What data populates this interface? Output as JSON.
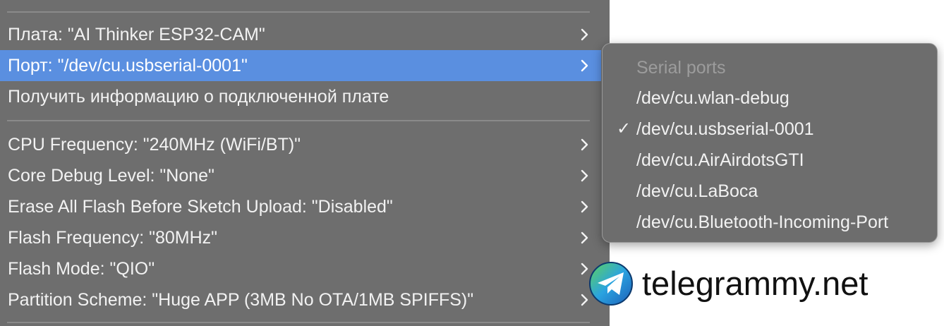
{
  "menu": {
    "items": [
      {
        "label": "Плата: \"AI Thinker ESP32-CAM\"",
        "has_submenu": true
      },
      {
        "label": "Порт: \"/dev/cu.usbserial-0001\"",
        "has_submenu": true,
        "highlighted": true
      },
      {
        "label": "Получить информацию о подключенной плате",
        "has_submenu": false
      },
      {
        "label": "CPU Frequency: \"240MHz (WiFi/BT)\"",
        "has_submenu": true
      },
      {
        "label": "Core Debug Level: \"None\"",
        "has_submenu": true
      },
      {
        "label": "Erase All Flash Before Sketch Upload: \"Disabled\"",
        "has_submenu": true
      },
      {
        "label": "Flash Frequency: \"80MHz\"",
        "has_submenu": true
      },
      {
        "label": "Flash Mode: \"QIO\"",
        "has_submenu": true
      },
      {
        "label": "Partition Scheme: \"Huge APP (3MB No OTA/1MB SPIFFS)\"",
        "has_submenu": true
      }
    ],
    "chevron_icon": "chevron-right-icon"
  },
  "submenu": {
    "header": "Serial ports",
    "check_glyph": "✓",
    "items": [
      {
        "label": "/dev/cu.wlan-debug",
        "checked": false
      },
      {
        "label": "/dev/cu.usbserial-0001",
        "checked": true
      },
      {
        "label": "/dev/cu.AirAirdotsGTI",
        "checked": false
      },
      {
        "label": "/dev/cu.LaBoca",
        "checked": false
      },
      {
        "label": "/dev/cu.Bluetooth-Incoming-Port",
        "checked": false
      }
    ]
  },
  "watermark": {
    "text": "telegrammy.net",
    "icon": "telegram-logo-icon"
  },
  "colors": {
    "menu_bg": "#6e6e6e",
    "highlight": "#5a8fe0",
    "text": "#f2f2f2",
    "disabled_text": "#9c9c9c"
  }
}
